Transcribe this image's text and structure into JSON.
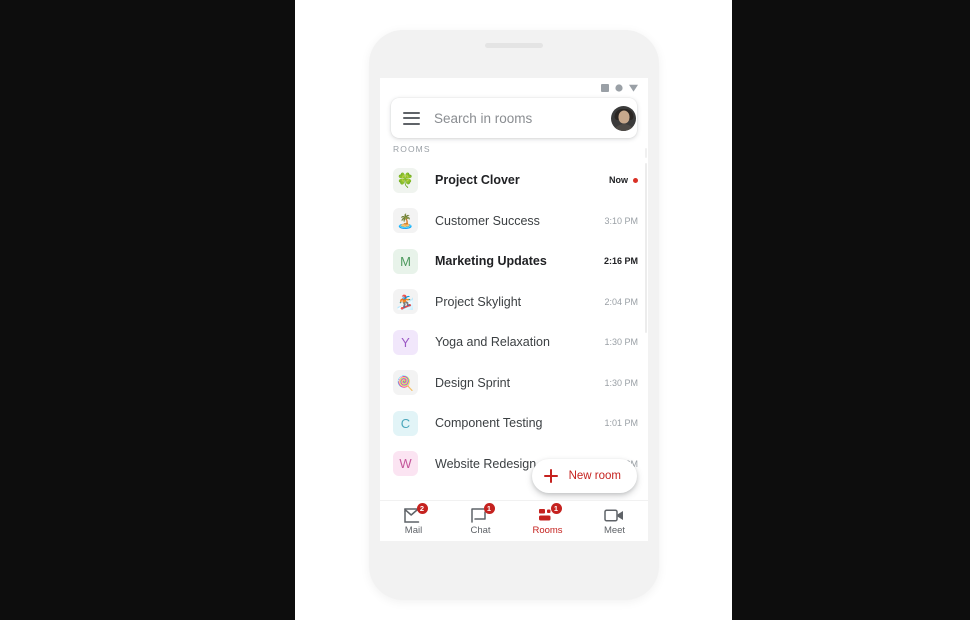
{
  "statusbar": {
    "icons": [
      "battery-icon",
      "wifi-icon",
      "signal-icon"
    ]
  },
  "search": {
    "menu_icon": "hamburger-menu-icon",
    "placeholder": "Search in rooms",
    "value": "",
    "avatar_name": "user-avatar"
  },
  "section": {
    "label": "ROOMS"
  },
  "rooms": [
    {
      "title": "Project Clover",
      "time": "Now",
      "unread": true,
      "avatar_type": "emoji",
      "avatar": "🍀",
      "avatar_bg": "#f0f4ef",
      "avatar_fg": "#1e8e3e",
      "has_dot": true
    },
    {
      "title": "Customer Success",
      "time": "3:10 PM",
      "unread": false,
      "avatar_type": "emoji",
      "avatar": "🏝️",
      "avatar_bg": "#f3f3f3",
      "avatar_fg": "#3c4043",
      "has_dot": false
    },
    {
      "title": "Marketing Updates",
      "time": "2:16 PM",
      "unread": true,
      "avatar_type": "letter",
      "avatar": "M",
      "avatar_bg": "#e8f3ea",
      "avatar_fg": "#4e9a5f",
      "has_dot": false
    },
    {
      "title": "Project Skylight",
      "time": "2:04 PM",
      "unread": false,
      "avatar_type": "emoji",
      "avatar": "🏂",
      "avatar_bg": "#f3f3f3",
      "avatar_fg": "#3c4043",
      "has_dot": false
    },
    {
      "title": "Yoga and Relaxation",
      "time": "1:30 PM",
      "unread": false,
      "avatar_type": "letter",
      "avatar": "Y",
      "avatar_bg": "#f1e7fb",
      "avatar_fg": "#9a57c4",
      "has_dot": false
    },
    {
      "title": "Design Sprint",
      "time": "1:30 PM",
      "unread": false,
      "avatar_type": "emoji",
      "avatar": "🍭",
      "avatar_bg": "#f3f3f3",
      "avatar_fg": "#3c4043",
      "has_dot": false
    },
    {
      "title": "Component Testing",
      "time": "1:01 PM",
      "unread": false,
      "avatar_type": "letter",
      "avatar": "C",
      "avatar_bg": "#e2f4f7",
      "avatar_fg": "#4aa6bb",
      "has_dot": false
    },
    {
      "title": "Website Redesign",
      "time": "1:00 PM",
      "unread": false,
      "avatar_type": "letter",
      "avatar": "W",
      "avatar_bg": "#fbe4f2",
      "avatar_fg": "#c4569a",
      "has_dot": false
    }
  ],
  "fab": {
    "icon": "plus-icon",
    "label": "New room"
  },
  "bottom_nav": [
    {
      "label": "Mail",
      "icon": "mail-icon",
      "badge": "2",
      "active": false
    },
    {
      "label": "Chat",
      "icon": "chat-icon",
      "badge": "1",
      "active": false
    },
    {
      "label": "Rooms",
      "icon": "rooms-icon",
      "badge": "1",
      "active": true
    },
    {
      "label": "Meet",
      "icon": "meet-icon",
      "badge": "",
      "active": false
    }
  ],
  "colors": {
    "accent_red": "#c5221f",
    "text_primary": "#3c4043",
    "text_secondary": "#9aa0a6",
    "phone_frame": "#f2f2f2"
  }
}
